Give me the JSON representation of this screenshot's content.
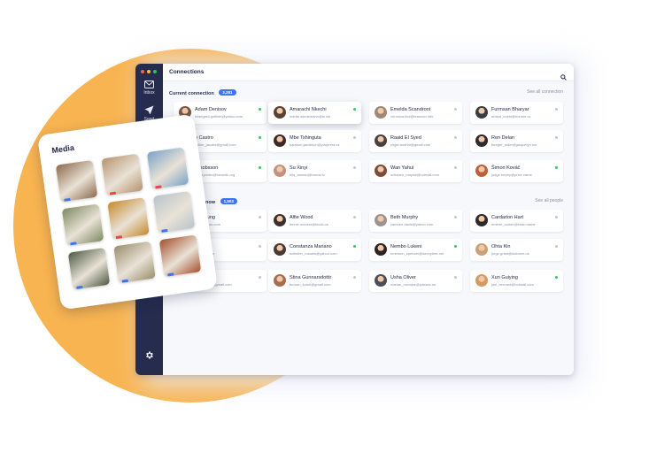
{
  "window": {
    "title": "Connections",
    "traffic_lights": [
      "#ff5f57",
      "#febc2e",
      "#28c840"
    ]
  },
  "sidebar": {
    "items": [
      {
        "label": "Inbox",
        "icon": "mail-icon"
      },
      {
        "label": "Send",
        "icon": "paper-plane-icon"
      }
    ],
    "settings_icon": "gear-icon"
  },
  "colors": {
    "accent": "#3f73f2",
    "online": "#2ecc5a",
    "offline": "#c3c7d4",
    "sidebar": "#262c4e",
    "blob": "#f8b451"
  },
  "current": {
    "heading": "Current connection",
    "count": "3,281",
    "see_all": "See all connection"
  },
  "know": {
    "heading_fragment": "know",
    "count": "1,503",
    "see_all": "See all people"
  },
  "contacts": [
    {
      "name": "Adam Denisov",
      "email": "hildegard.gottlieb@yahoo.com",
      "online": true,
      "avatar": "#7a5846"
    },
    {
      "name": "Amarachi Nkechi",
      "email": "mertie.stiedemann@bi.biz",
      "online": true,
      "avatar": "#5b4034"
    },
    {
      "name": "Emelda Scandroot",
      "email": "veronica.lind@leannon.info",
      "online": false,
      "avatar": "#a08778"
    },
    {
      "name": "Furmsan Bharyar",
      "email": "erland_koehl@hormer.cz",
      "online": false,
      "avatar": "#3b3b44"
    },
    {
      "name": "n Castro",
      "email": "celine_jacobs@gmail.com",
      "online": true,
      "avatar": "#6b5a52"
    },
    {
      "name": "Mbe Tshinguta",
      "email": "harrison.jacobson@yduprest.us",
      "online": false,
      "avatar": "#3e2a24"
    },
    {
      "name": "Raaid El Syed",
      "email": "virgie.boehm@gmail.com",
      "online": false,
      "avatar": "#4a4040"
    },
    {
      "name": "Ren Delan",
      "email": "foreger_elder@jacquelyn.me",
      "online": false,
      "avatar": "#2f2b2d"
    },
    {
      "name": "Jakobsson",
      "email": "porta.pedro@binomik.org",
      "online": true,
      "avatar": "#9a7a68"
    },
    {
      "name": "Su Xinyi",
      "email": "kris_stanon@bunos.tv",
      "online": false,
      "avatar": "#c39380"
    },
    {
      "name": "Wan Yahui",
      "email": "schaden_maynd@hotmail.com",
      "online": false,
      "avatar": "#7a4e3a"
    },
    {
      "name": "Šimon Kováč",
      "email": "judge.torphy@price.name",
      "online": true,
      "avatar": "#c0603a"
    },
    {
      "name": "der Ljung",
      "email": "lott@yahoo.com",
      "online": false,
      "avatar": "#8a7060"
    },
    {
      "name": "Alfie Wood",
      "email": "lennie.ruecker@block.us",
      "online": false,
      "avatar": "#3c3030"
    },
    {
      "name": "Beth Murphy",
      "email": "camden.davis@yahoo.com",
      "online": false,
      "avatar": "#9c948e"
    },
    {
      "name": "Cardarion Hart",
      "email": "emerie_corker@brian.name",
      "online": false,
      "avatar": "#2e2a2b"
    },
    {
      "name": "on",
      "email": "@gmail.com",
      "online": false,
      "avatar": "#a48c7c"
    },
    {
      "name": "Constanza Mariano",
      "email": "schleifer_rosales@yahoo.com",
      "online": true,
      "avatar": "#4b3a32"
    },
    {
      "name": "Nembo Lukeni",
      "email": "emerson_spencer@kennytree.net",
      "online": true,
      "avatar": "#2d2424"
    },
    {
      "name": "Ohta Kin",
      "email": "jorge.grant@dalonne.us",
      "online": false,
      "avatar": "#c9a27a"
    },
    {
      "name": "roch",
      "email": "allan_cone@gmail.com",
      "online": false,
      "avatar": "#7d6b60"
    },
    {
      "name": "Stina Gunnarsdottir",
      "email": "furman_kohel@gmail.com",
      "online": false,
      "avatar": "#a86d50"
    },
    {
      "name": "Usha Oliver",
      "email": "marian_romaine@passes.us",
      "online": false,
      "avatar": "#4b4d59"
    },
    {
      "name": "Xun Guiying",
      "email": "joel_bernard@hotmail.com",
      "online": true,
      "avatar": "#d39a62"
    }
  ],
  "media": {
    "title": "Media",
    "thumbs": [
      {
        "name": "dog-photo",
        "bg": "#8d6a4d",
        "tag": "#3f73f2"
      },
      {
        "name": "street-photo",
        "bg": "#b7936f",
        "tag": "#ef4444"
      },
      {
        "name": "sky-photo",
        "bg": "#7aa3c8",
        "tag": "#ef4444"
      },
      {
        "name": "field-photo",
        "bg": "#7d8a62",
        "tag": "#3f73f2"
      },
      {
        "name": "tropical-photo",
        "bg": "#c58a2c",
        "tag": "#ef4444"
      },
      {
        "name": "hands-photo",
        "bg": "#b9c4cc",
        "tag": "#3f73f2"
      },
      {
        "name": "forest-photo",
        "bg": "#4d5a43",
        "tag": "#3f73f2"
      },
      {
        "name": "desk-photo",
        "bg": "#9a8e6c",
        "tag": "#3f73f2"
      },
      {
        "name": "window-photo",
        "bg": "#a5502e",
        "tag": "#3f73f2"
      }
    ]
  }
}
